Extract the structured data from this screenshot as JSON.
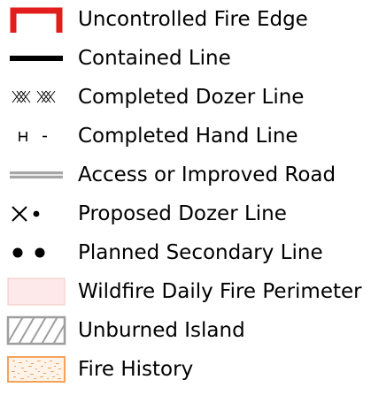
{
  "legend": {
    "items": [
      {
        "label": "Uncontrolled Fire Edge",
        "icon": "uncontrolled-fire-edge-icon",
        "color": "#e31c1c"
      },
      {
        "label": "Contained Line",
        "icon": "contained-line-icon",
        "color": "#000000"
      },
      {
        "label": "Completed Dozer Line",
        "icon": "completed-dozer-line-icon",
        "color": "#000000"
      },
      {
        "label": "Completed Hand Line",
        "icon": "completed-hand-line-icon",
        "color": "#000000"
      },
      {
        "label": "Access or Improved Road",
        "icon": "access-road-icon",
        "color": "#a6a6a6"
      },
      {
        "label": "Proposed Dozer Line",
        "icon": "proposed-dozer-line-icon",
        "color": "#000000"
      },
      {
        "label": "Planned Secondary Line",
        "icon": "planned-secondary-line-icon",
        "color": "#000000"
      },
      {
        "label": "Wildfire Daily Fire Perimeter",
        "icon": "fire-perimeter-icon",
        "color": "#fde9e9"
      },
      {
        "label": "Unburned Island",
        "icon": "unburned-island-icon",
        "color": "#9e9e9e"
      },
      {
        "label": "Fire History",
        "icon": "fire-history-icon",
        "color": "#f5a25a"
      }
    ]
  }
}
